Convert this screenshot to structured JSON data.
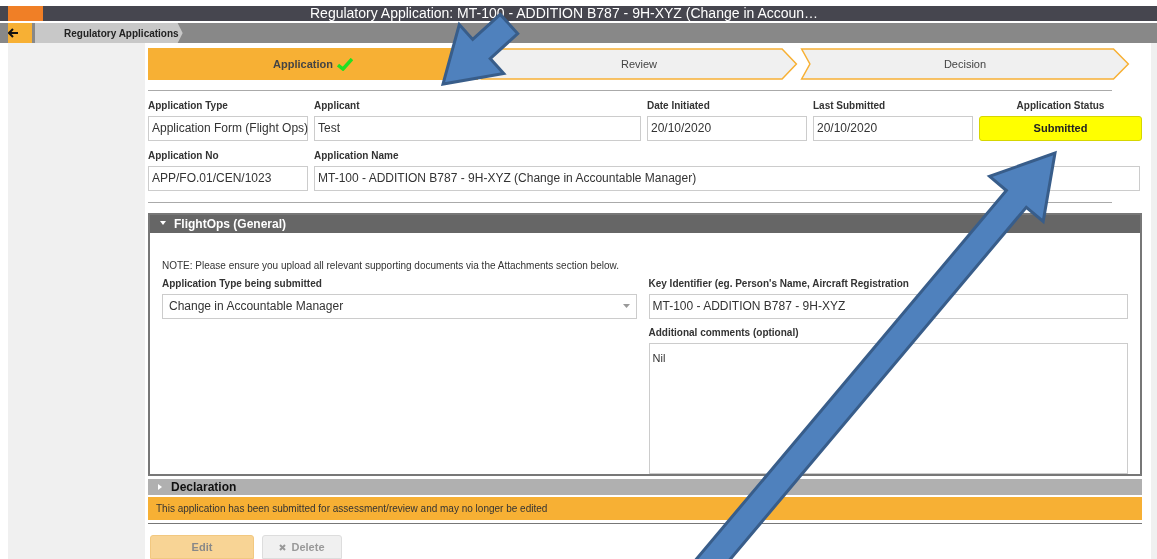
{
  "window": {
    "title": "Regulatory Application: MT-100 - ADDITION B787 - 9H-XYZ (Change in Accoun…"
  },
  "breadcrumb": {
    "items": [
      "Regulatory Applications"
    ]
  },
  "stepper": [
    {
      "label": "Application",
      "selected": true,
      "done": true
    },
    {
      "label": "Review",
      "selected": false,
      "done": false
    },
    {
      "label": "Decision",
      "selected": false,
      "done": false
    }
  ],
  "header_fields": [
    {
      "label": "Application Type",
      "value": "Application Form (Flight Ops)",
      "kind": "field"
    },
    {
      "label": "Applicant",
      "value": "Test",
      "kind": "field"
    },
    {
      "label": "Date Initiated",
      "value": "20/10/2020",
      "kind": "field"
    },
    {
      "label": "Last Submitted",
      "value": "20/10/2020",
      "kind": "field"
    },
    {
      "label": "Application Status",
      "value": "Submitted",
      "kind": "status"
    },
    {
      "label": "Application No",
      "value": "APP/FO.01/CEN/1023",
      "kind": "field"
    },
    {
      "label": "Application Name",
      "value": "MT-100 - ADDITION B787 - 9H-XYZ (Change in Accountable Manager)",
      "kind": "field"
    }
  ],
  "section": {
    "title": "FlightOps (General)",
    "expanded": true,
    "note": "NOTE: Please ensure you upload all relevant supporting documents via the Attachments section below.",
    "application_type": {
      "label": "Application Type being submitted",
      "value": "Change in Accountable Manager"
    },
    "key_identifier": {
      "label": "Key Identifier (eg. Person's Name, Aircraft Registration",
      "value": "MT-100 - ADDITION B787 - 9H-XYZ"
    },
    "comments": {
      "label": "Additional comments (optional)",
      "value": "Nil"
    }
  },
  "collapsed_section": {
    "title": "Declaration",
    "expanded": false
  },
  "message": "This application has been submitted for assessment/review and may no longer be edited",
  "buttons": [
    {
      "label": "Edit",
      "kind": "edit",
      "disabled": true
    },
    {
      "label": "Delete",
      "kind": "delete",
      "disabled": true
    }
  ]
}
